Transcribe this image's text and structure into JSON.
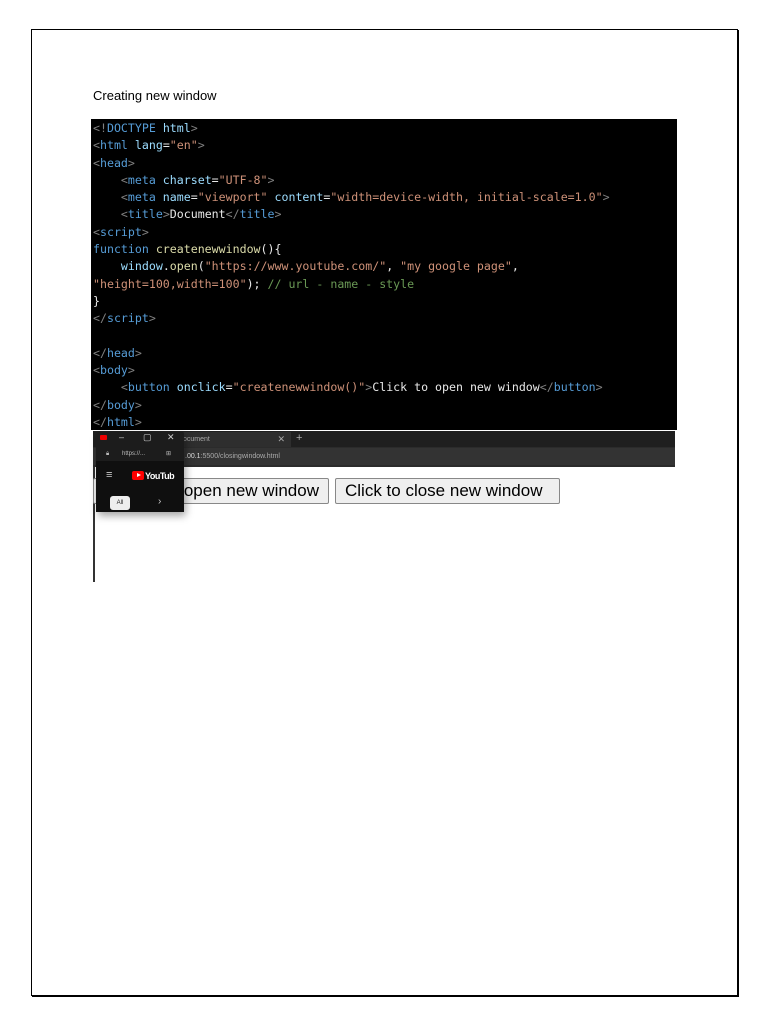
{
  "caption": "Creating new window",
  "code_lines": [
    [
      [
        "t-b",
        "<!"
      ],
      [
        "t-tag",
        "DOCTYPE"
      ],
      [
        "t-attr",
        " html"
      ],
      [
        "t-b",
        ">"
      ]
    ],
    [
      [
        "t-b",
        "<"
      ],
      [
        "t-tag",
        "html"
      ],
      [
        "t-attr",
        " lang"
      ],
      [
        "t-txt",
        "="
      ],
      [
        "t-str",
        "\"en\""
      ],
      [
        "t-b",
        ">"
      ]
    ],
    [
      [
        "t-b",
        "<"
      ],
      [
        "t-tag",
        "head"
      ],
      [
        "t-b",
        ">"
      ]
    ],
    [
      [
        "t-txt",
        "    "
      ],
      [
        "t-b",
        "<"
      ],
      [
        "t-tag",
        "meta"
      ],
      [
        "t-attr",
        " charset"
      ],
      [
        "t-txt",
        "="
      ],
      [
        "t-str",
        "\"UTF-8\""
      ],
      [
        "t-b",
        ">"
      ]
    ],
    [
      [
        "t-txt",
        "    "
      ],
      [
        "t-b",
        "<"
      ],
      [
        "t-tag",
        "meta"
      ],
      [
        "t-attr",
        " name"
      ],
      [
        "t-txt",
        "="
      ],
      [
        "t-str",
        "\"viewport\""
      ],
      [
        "t-attr",
        " content"
      ],
      [
        "t-txt",
        "="
      ],
      [
        "t-str",
        "\"width=device-width, initial-scale=1.0\""
      ],
      [
        "t-b",
        ">"
      ]
    ],
    [
      [
        "t-txt",
        "    "
      ],
      [
        "t-b",
        "<"
      ],
      [
        "t-tag",
        "title"
      ],
      [
        "t-b",
        ">"
      ],
      [
        "t-txt",
        "Document"
      ],
      [
        "t-b",
        "</"
      ],
      [
        "t-tag",
        "title"
      ],
      [
        "t-b",
        ">"
      ]
    ],
    [
      [
        "t-b",
        "<"
      ],
      [
        "t-tag",
        "script"
      ],
      [
        "t-b",
        ">"
      ]
    ],
    [
      [
        "t-kw",
        "function"
      ],
      [
        "t-fn",
        " createnewwindow"
      ],
      [
        "t-txt",
        "(){"
      ]
    ],
    [
      [
        "t-txt",
        "    "
      ],
      [
        "t-attr",
        "window"
      ],
      [
        "t-txt",
        "."
      ],
      [
        "t-fn",
        "open"
      ],
      [
        "t-txt",
        "("
      ],
      [
        "t-str",
        "\"https://www.youtube.com/\""
      ],
      [
        "t-txt",
        ", "
      ],
      [
        "t-str",
        "\"my google page\""
      ],
      [
        "t-txt",
        ","
      ]
    ],
    [
      [
        "t-str",
        "\"height=100,width=100\""
      ],
      [
        "t-txt",
        "); "
      ],
      [
        "t-cm",
        "// url - name - style"
      ]
    ],
    [
      [
        "t-txt",
        "}"
      ]
    ],
    [
      [
        "t-b",
        "</"
      ],
      [
        "t-tag",
        "script"
      ],
      [
        "t-b",
        ">"
      ]
    ],
    [
      [
        "t-txt",
        ""
      ]
    ],
    [
      [
        "t-b",
        "</"
      ],
      [
        "t-tag",
        "head"
      ],
      [
        "t-b",
        ">"
      ]
    ],
    [
      [
        "t-b",
        "<"
      ],
      [
        "t-tag",
        "body"
      ],
      [
        "t-b",
        ">"
      ]
    ],
    [
      [
        "t-txt",
        "    "
      ],
      [
        "t-b",
        "<"
      ],
      [
        "t-tag",
        "button"
      ],
      [
        "t-attr",
        " onclick"
      ],
      [
        "t-txt",
        "="
      ],
      [
        "t-str",
        "\"createnewwindow()\""
      ],
      [
        "t-b",
        ">"
      ],
      [
        "t-txt",
        "Click to open new window"
      ],
      [
        "t-b",
        "</"
      ],
      [
        "t-tag",
        "button"
      ],
      [
        "t-b",
        ">"
      ]
    ],
    [
      [
        "t-b",
        "</"
      ],
      [
        "t-tag",
        "body"
      ],
      [
        "t-b",
        ">"
      ]
    ],
    [
      [
        "t-b",
        "</"
      ],
      [
        "t-tag",
        "html"
      ],
      [
        "t-b",
        ">"
      ]
    ]
  ],
  "browser": {
    "tab_title": "ocument",
    "url_host": ".00.1",
    "url_path": ":5500/closingwindow.html",
    "open_button": "open new window",
    "close_button": "Click to close new window"
  },
  "popup": {
    "url": "https://...",
    "logo": "YouTub",
    "chip": "All"
  }
}
